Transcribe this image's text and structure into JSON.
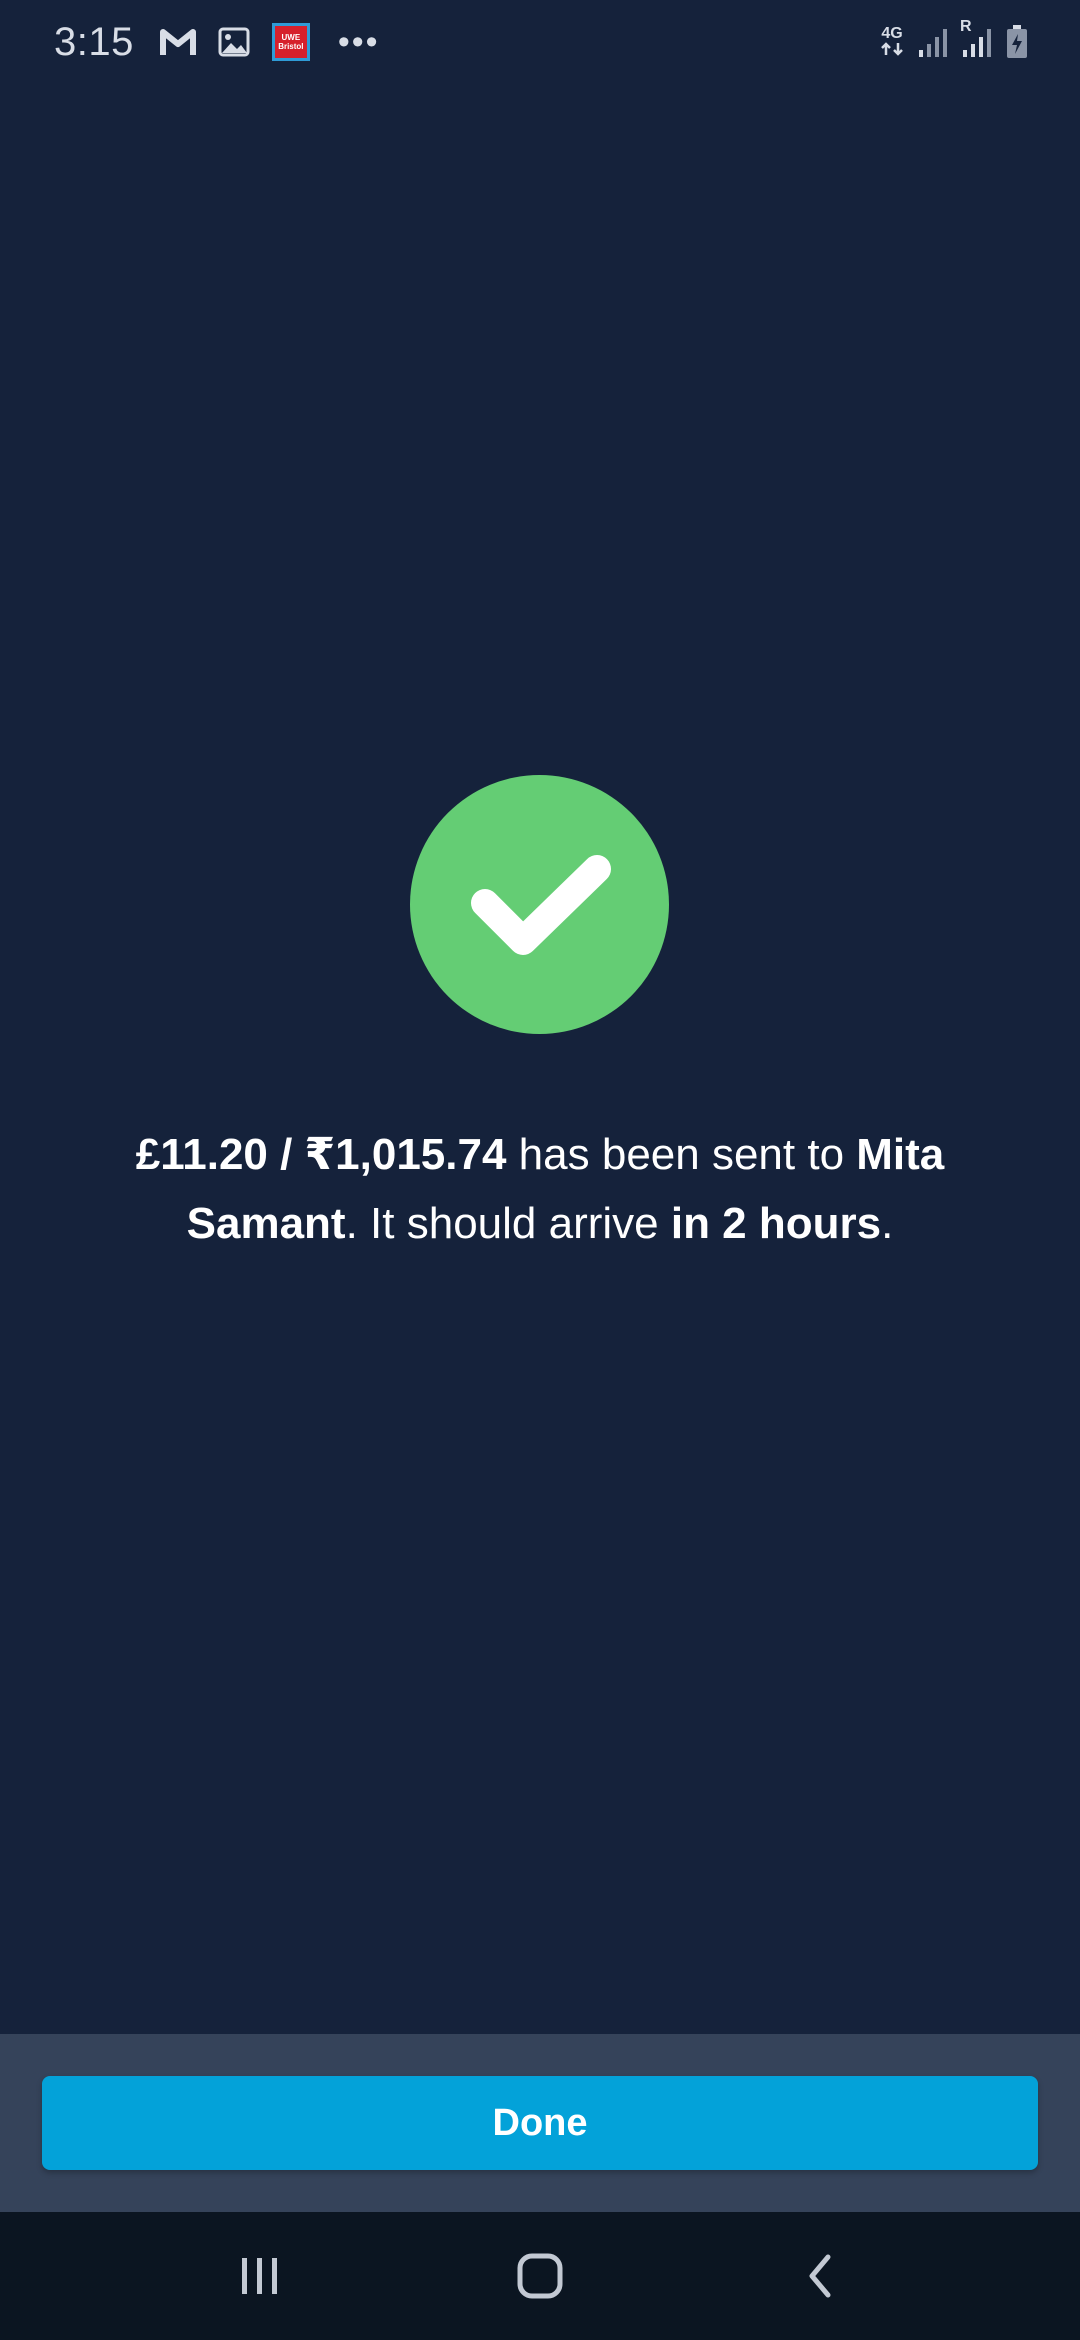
{
  "status_bar": {
    "time": "3:15",
    "app_icons": [
      "gmail-style-m-icon",
      "gallery-image-icon",
      "uwe-bristol-app-icon"
    ],
    "uwe_icon_text": [
      "UWE",
      "Bristol"
    ],
    "more_indicator": "•••",
    "network_label": "4G",
    "roaming_label": "R"
  },
  "success": {
    "icon": "checkmark-icon",
    "accent_color": "#64cd74"
  },
  "message": {
    "amount": "£11.20 / ₹1,015.74",
    "text_1": " has been sent to ",
    "recipient": "Mita Samant",
    "text_2": ". It should arrive ",
    "arrival": "in 2 hours",
    "text_3": "."
  },
  "action": {
    "done_label": "Done",
    "button_color": "#03a2d9"
  },
  "nav_bar": {
    "icons": [
      "recent-apps-icon",
      "home-icon",
      "back-icon"
    ]
  }
}
